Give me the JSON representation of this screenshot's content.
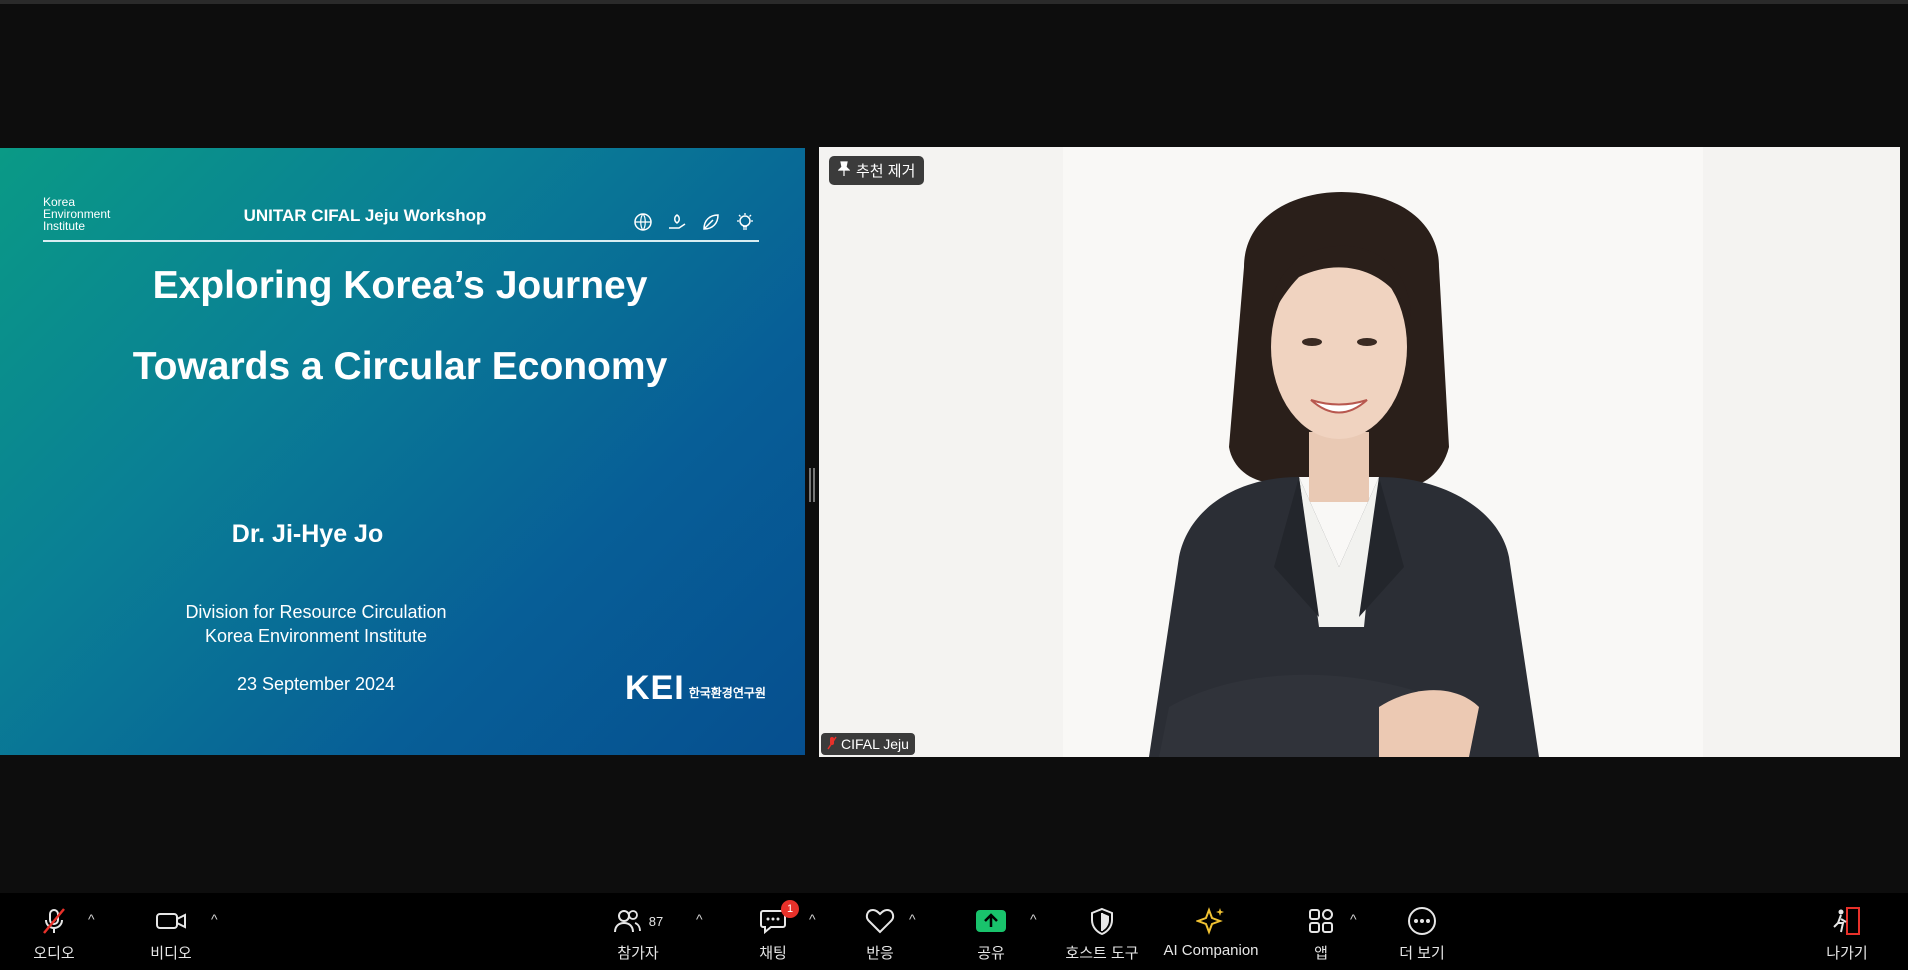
{
  "slide": {
    "org_small_lines": [
      "Korea",
      "Environment",
      "Institute"
    ],
    "workshop": "UNITAR CIFAL Jeju Workshop",
    "title_line1": "Exploring Korea’s Journey",
    "title_line2": "Towards a Circular Economy",
    "presenter": "Dr. Ji-Hye Jo",
    "division": "Division for Resource Circulation",
    "institute": "Korea Environment Institute",
    "date": "23 September 2024",
    "logo_text": "KEI",
    "logo_korean": "한국환경연구원",
    "header_icons": [
      "globe-icon",
      "hand-plant-icon",
      "leaf-icon",
      "lightbulb-icon"
    ]
  },
  "video": {
    "pin_label": "추천 제거",
    "participant_name": "CIFAL Jeju",
    "participant_muted": true
  },
  "toolbar": {
    "audio_label": "오디오",
    "video_label": "비디오",
    "participants_label": "참가자",
    "participants_count": "87",
    "chat_label": "채팅",
    "chat_badge": "1",
    "reactions_label": "반응",
    "share_label": "공유",
    "host_tools_label": "호스트 도구",
    "ai_label": "AI Companion",
    "apps_label": "앱",
    "more_label": "더 보기",
    "leave_label": "나가기",
    "caret": "^"
  },
  "colors": {
    "share_green": "#19c36c",
    "ai_gold": "#f1c232",
    "badge_red": "#e8312a",
    "leave_red": "#e8312a"
  }
}
